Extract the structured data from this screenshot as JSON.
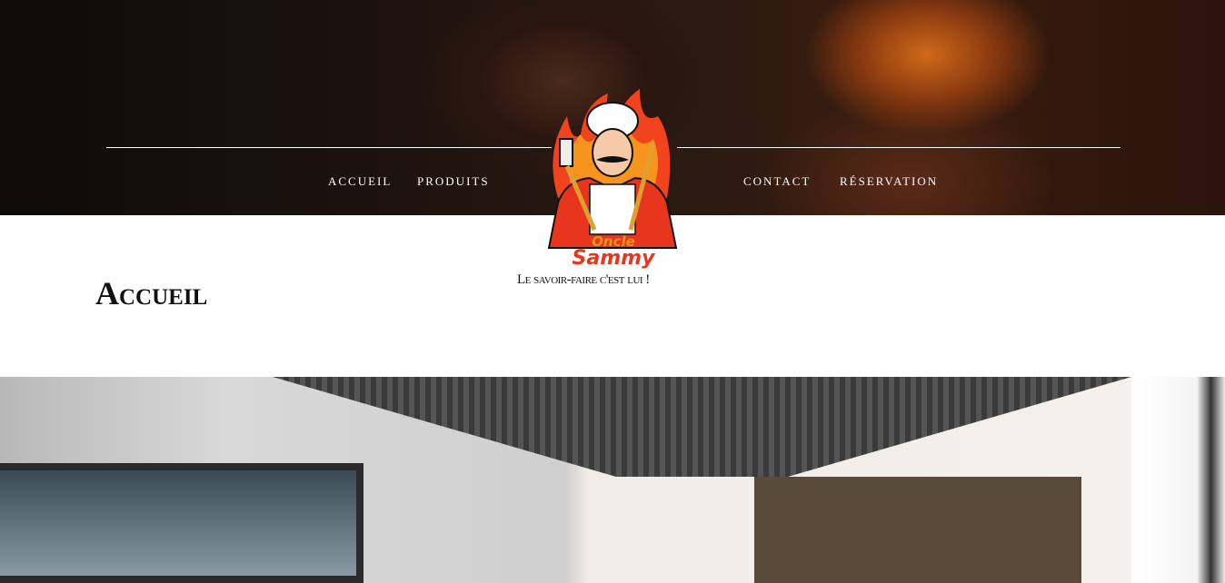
{
  "nav": {
    "items": [
      {
        "label": "ACCUEIL"
      },
      {
        "label": "PRODUITS"
      },
      {
        "label": "CONTACT"
      },
      {
        "label": "RÉSERVATION"
      }
    ]
  },
  "logo": {
    "line1": "Oncle",
    "line2": "Sammy"
  },
  "tagline": "Le savoir-faire c'est lui !",
  "page_title": "Accueil",
  "colors": {
    "logo_red": "#e8361e",
    "logo_orange": "#f7941d"
  }
}
